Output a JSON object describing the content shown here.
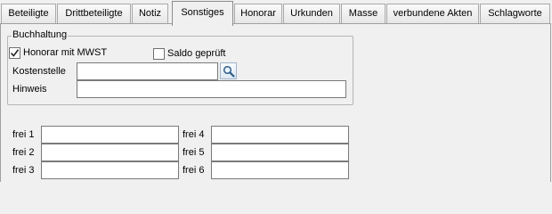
{
  "tabs": [
    {
      "label": "Beteiligte",
      "active": false
    },
    {
      "label": "Drittbeteiligte",
      "active": false
    },
    {
      "label": "Notiz",
      "active": false
    },
    {
      "label": "Sonstiges",
      "active": true
    },
    {
      "label": "Honorar",
      "active": false
    },
    {
      "label": "Urkunden",
      "active": false
    },
    {
      "label": "Masse",
      "active": false
    },
    {
      "label": "verbundene Akten",
      "active": false
    },
    {
      "label": "Schlagworte",
      "active": false
    }
  ],
  "buchhaltung": {
    "title": "Buchhaltung",
    "honorar_mwst": {
      "label": "Honorar mit MWST",
      "checked": true
    },
    "saldo_geprueft": {
      "label": "Saldo geprüft",
      "checked": false
    },
    "kostenstelle": {
      "label": "Kostenstelle",
      "value": ""
    },
    "hinweis": {
      "label": "Hinweis",
      "value": ""
    }
  },
  "frei": [
    {
      "label": "frei 1",
      "value": ""
    },
    {
      "label": "frei 2",
      "value": ""
    },
    {
      "label": "frei 3",
      "value": ""
    },
    {
      "label": "frei 4",
      "value": ""
    },
    {
      "label": "frei 5",
      "value": ""
    },
    {
      "label": "frei 6",
      "value": ""
    }
  ],
  "icons": {
    "kostenstelle_search": "magnifier-icon",
    "checkmark": "checkmark-icon"
  }
}
